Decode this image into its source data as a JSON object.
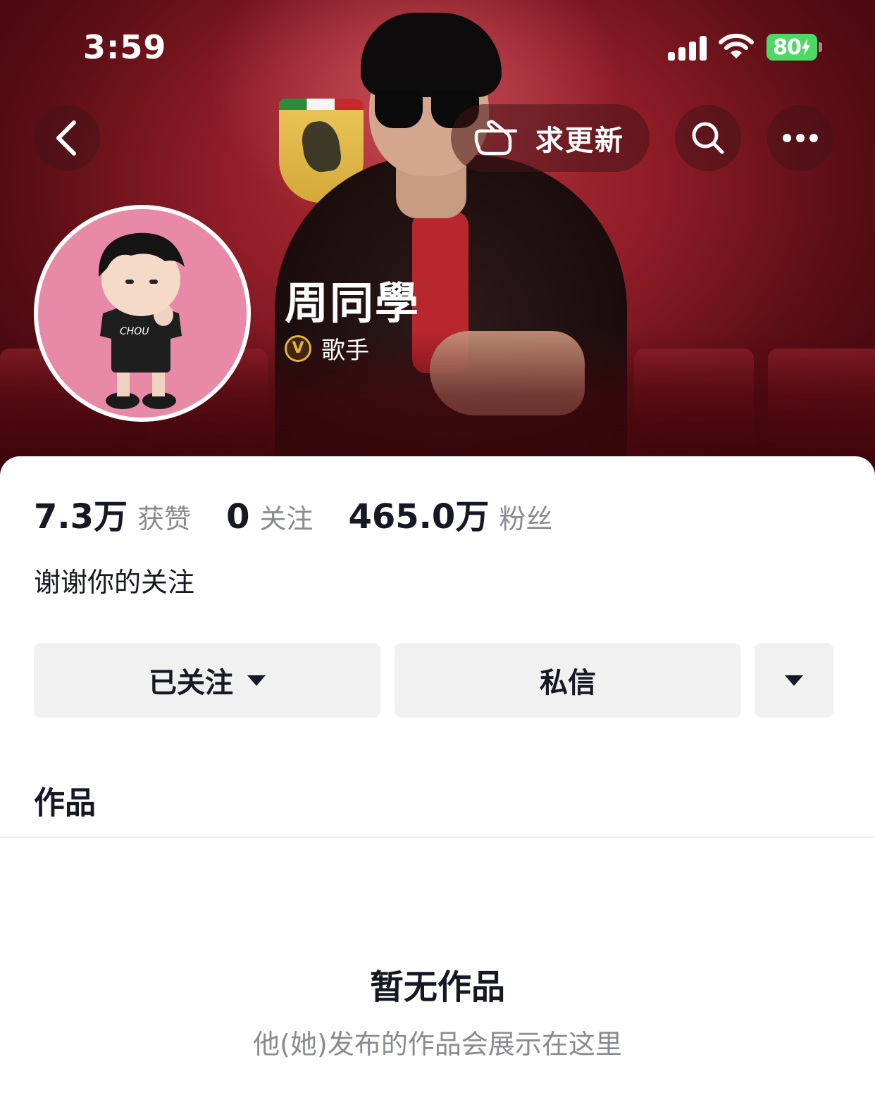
{
  "status_bar": {
    "time": "3:59",
    "battery": "80"
  },
  "header": {
    "back_icon": "chevron-left-icon",
    "request_update_label": "求更新",
    "search_icon": "search-icon",
    "more_icon": "ellipsis-icon"
  },
  "profile": {
    "name": "周同學",
    "verify_badge_letter": "V",
    "verify_label": "歌手",
    "bio": "谢谢你的关注"
  },
  "stats": [
    {
      "value": "7.3万",
      "label": "获赞"
    },
    {
      "value": "0",
      "label": "关注"
    },
    {
      "value": "465.0万",
      "label": "粉丝"
    }
  ],
  "actions": {
    "follow_label": "已关注",
    "message_label": "私信"
  },
  "works": {
    "tab_label": "作品",
    "empty_title": "暂无作品",
    "empty_subtitle": "他(她)发布的作品会展示在这里"
  },
  "colors": {
    "hero_red": "#8e1c27",
    "verify_gold": "#e8b23a",
    "battery_green": "#4cd964",
    "button_bg": "#f1f1f2"
  }
}
